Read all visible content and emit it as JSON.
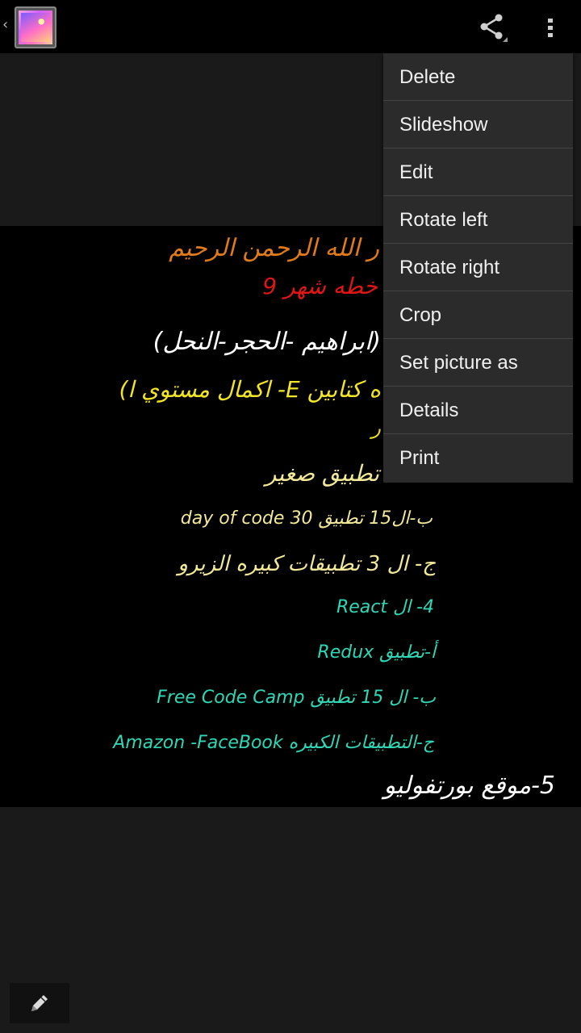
{
  "action_bar": {
    "up_caret": "‹",
    "app_icon": "gallery-app-icon",
    "share_icon": "share-icon",
    "overflow_icon": "overflow-menu-icon"
  },
  "photo": {
    "lines": [
      "ر الله الرحمن الرحيم",
      "خطه شهر 9",
      "(ابراهيم -الحجر-النحل)",
      "ه كتابين E- اكمال مستوي ا)",
      "ر",
      "تطبيق صغير",
      "ب-ال15 تطبيق 30 day of code",
      "ج- ال 3 تطبيقات كبيره الزيرو",
      "4- ال React",
      "أ-تطبيق Redux",
      "ب- ال 15 تطبيق Free Code Camp",
      "ج-التطبيقات الكبيره Amazon -FaceBook",
      "5-موقع بورتفوليو"
    ],
    "colors": {
      "orange": "#e07a1a",
      "red": "#e01515",
      "white": "#ffffff",
      "yellow": "#f2e526",
      "pale_yellow": "#f2e89a",
      "teal": "#2ed8b6"
    }
  },
  "menu": {
    "items": [
      "Delete",
      "Slideshow",
      "Edit",
      "Rotate left",
      "Rotate right",
      "Crop",
      "Set picture as",
      "Details",
      "Print"
    ]
  },
  "edit_button": {
    "icon": "pencil-icon"
  }
}
